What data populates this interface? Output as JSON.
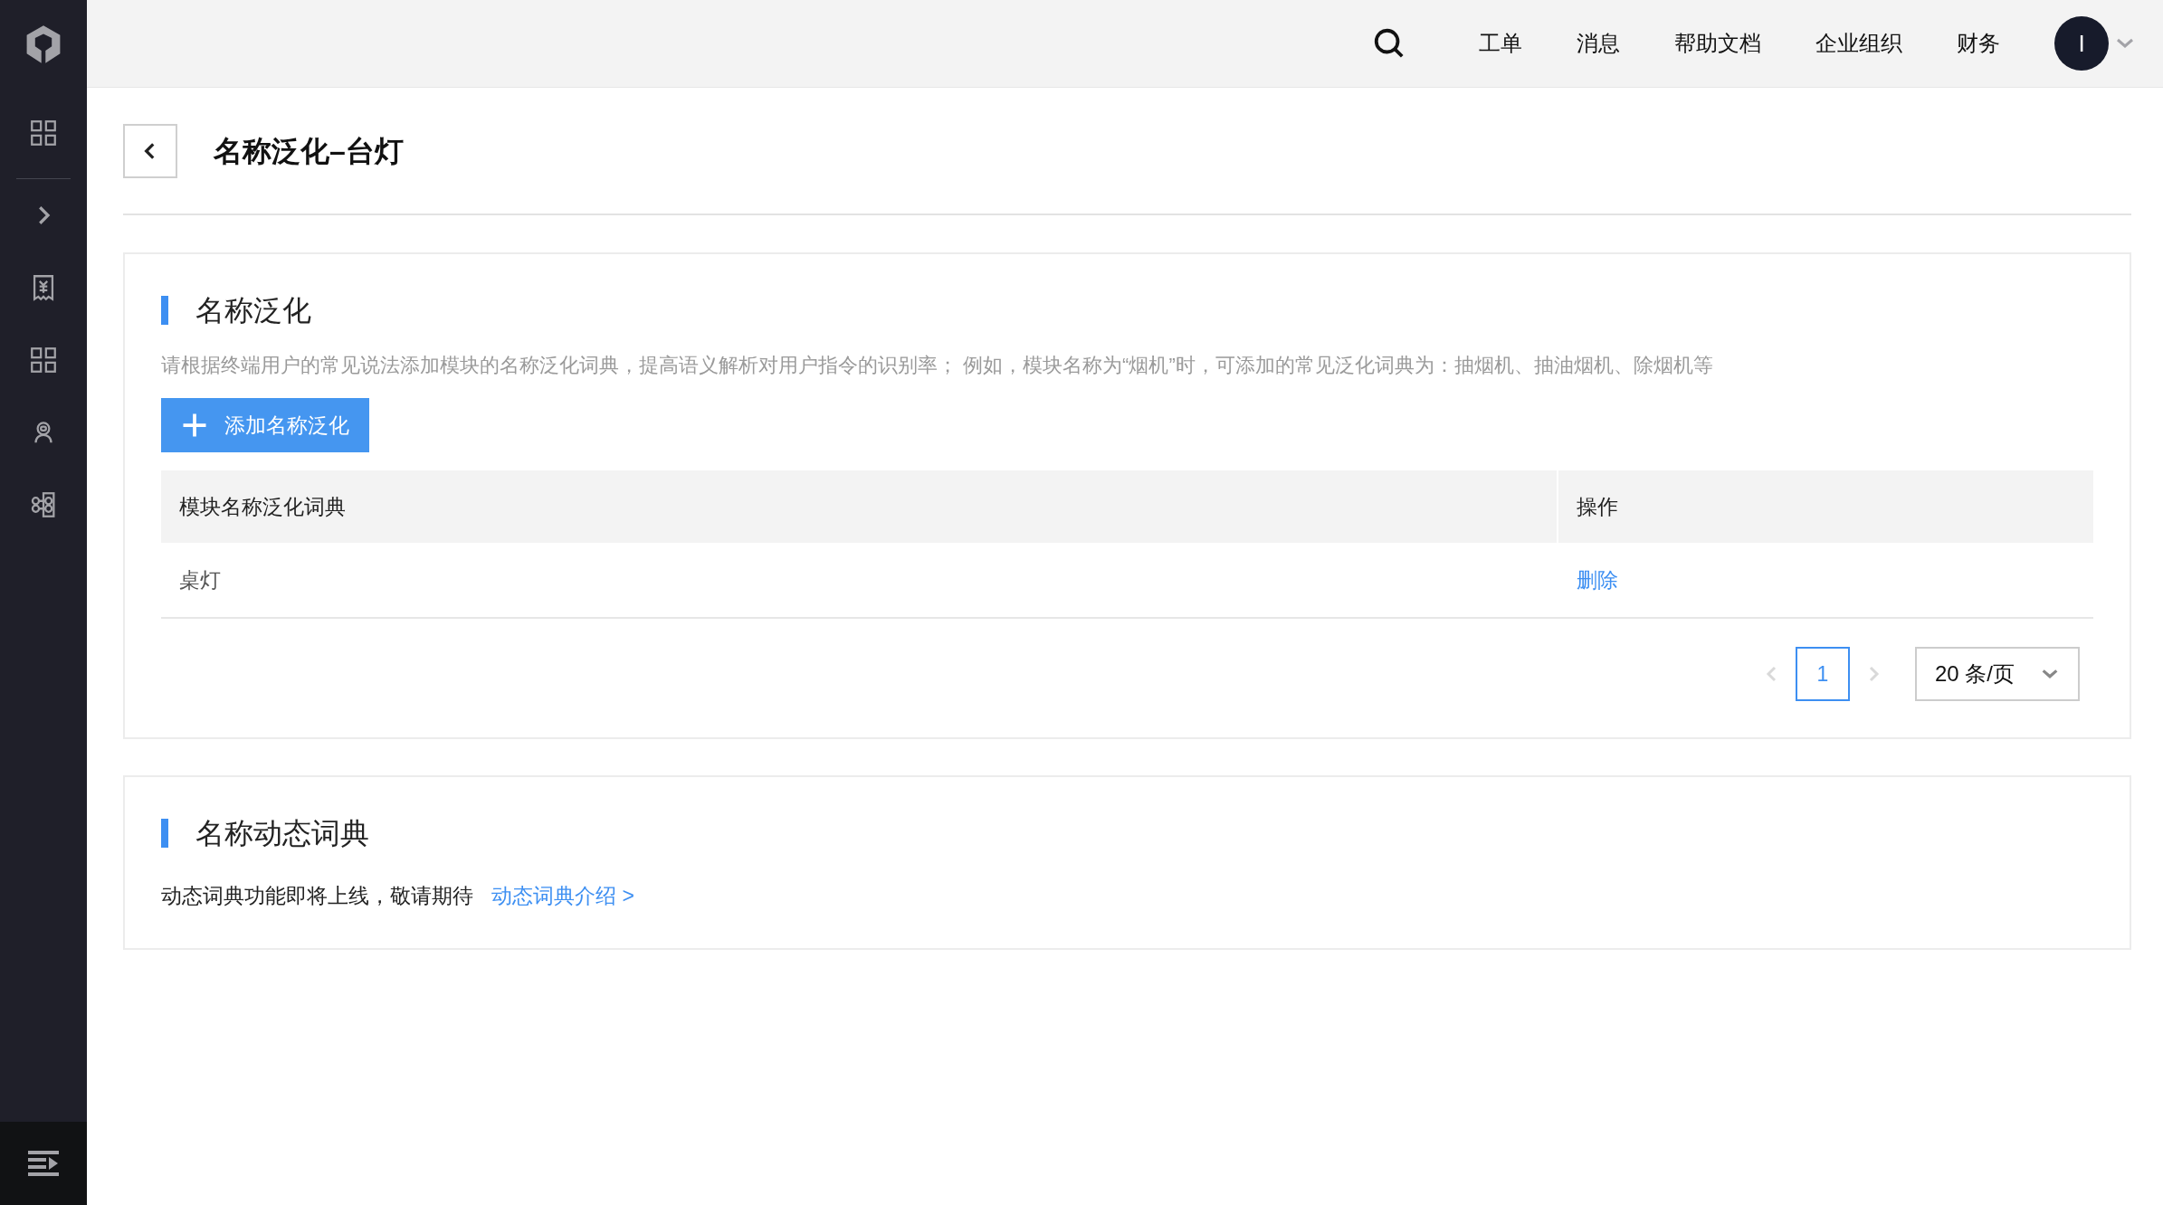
{
  "top_bar": {
    "nav_items": [
      "工单",
      "消息",
      "帮助文档",
      "企业组织",
      "财务"
    ],
    "avatar": "I"
  },
  "page": {
    "title": "名称泛化–台灯"
  },
  "generalization": {
    "heading": "名称泛化",
    "description": "请根据终端用户的常见说法添加模块的名称泛化词典，提高语义解析对用户指令的识别率； 例如，模块名称为“烟机”时，可添加的常见泛化词典为：抽烟机、抽油烟机、除烟机等",
    "add_button": "添加名称泛化",
    "table": {
      "columns": [
        "模块名称泛化词典",
        "操作"
      ],
      "rows": [
        {
          "term": "桌灯",
          "action": "删除"
        }
      ]
    },
    "pagination": {
      "pages": [
        {
          "label": "1",
          "selected": true
        }
      ],
      "page_size": "20 条/页"
    }
  },
  "dynamic": {
    "heading": "名称动态词典",
    "text": "动态词典功能即将上线，敬请期待",
    "link": "动态词典介绍 >"
  }
}
